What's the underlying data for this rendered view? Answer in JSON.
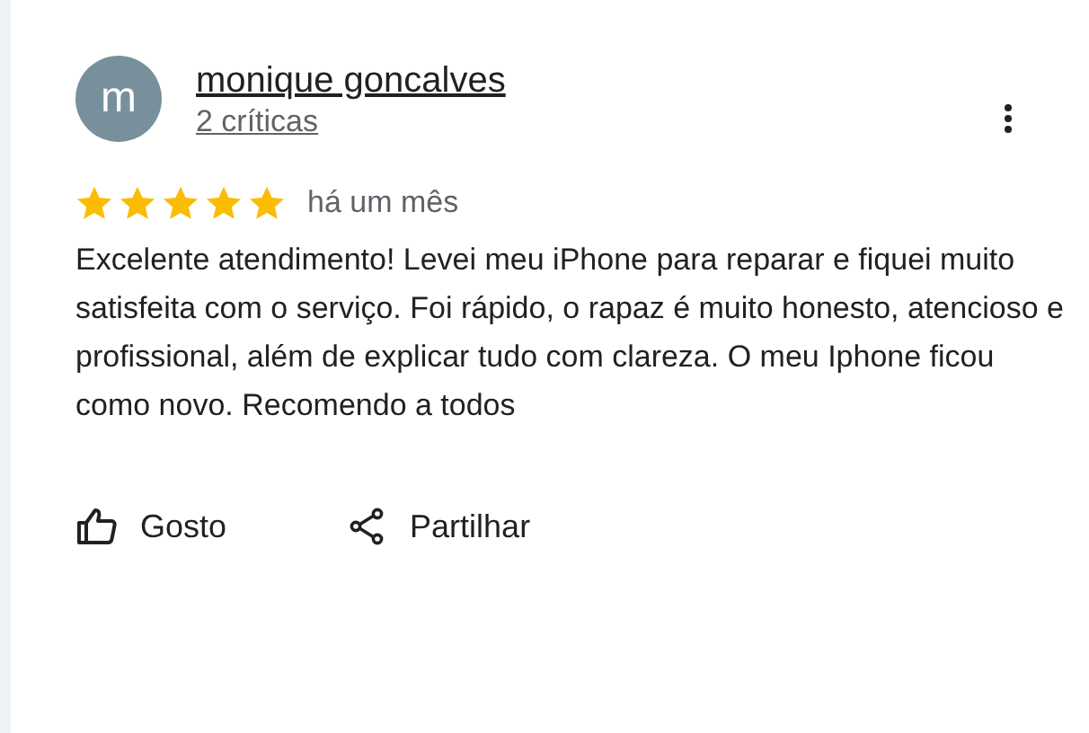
{
  "review": {
    "avatar_letter": "m",
    "author": "monique goncalves",
    "reviews_count": "2 críticas",
    "stars": 5,
    "date": "há um mês",
    "text": "Excelente atendimento! Levei meu iPhone para reparar e fiquei muito satisfeita com o serviço. Foi rápido, o rapaz é muito honesto, atencioso e profissional, além de explicar tudo com clareza. O meu Iphone ficou como novo. Recomendo a todos"
  },
  "actions": [
    {
      "kind": "like",
      "label": "Gosto"
    },
    {
      "kind": "share",
      "label": "Partilhar"
    }
  ]
}
